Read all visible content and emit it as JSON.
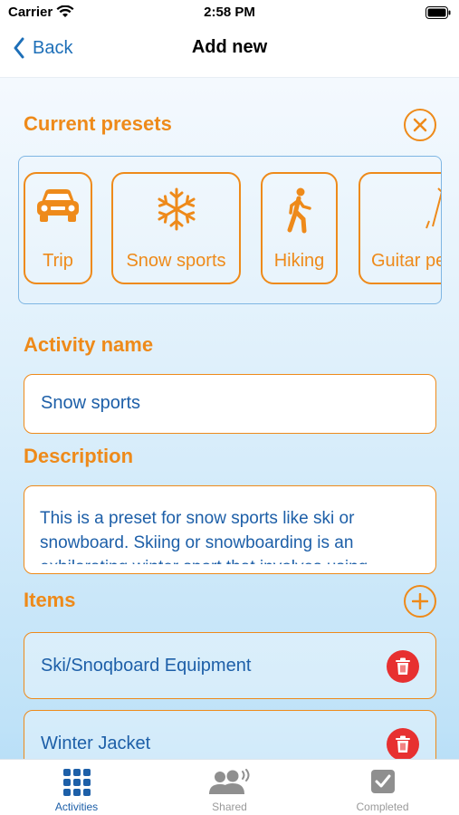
{
  "status_bar": {
    "carrier": "Carrier",
    "time": "2:58 PM"
  },
  "nav": {
    "back_label": "Back",
    "title": "Add new"
  },
  "presets": {
    "title": "Current presets",
    "items": [
      {
        "label": "Trip",
        "icon": "car-icon"
      },
      {
        "label": "Snow sports",
        "icon": "snowflake-icon"
      },
      {
        "label": "Hiking",
        "icon": "walking-person-icon"
      },
      {
        "label": "Guitar pe",
        "icon": "guitar-icon"
      }
    ]
  },
  "activity_name": {
    "label": "Activity name",
    "value": "Snow sports"
  },
  "description": {
    "label": "Description",
    "value": "This is a preset for snow sports like ski or snowboard. Skiing or snowboarding is an exhilarating winter sport that involves using"
  },
  "items_section": {
    "title": "Items",
    "items": [
      {
        "label": "Ski/Snoqboard Equipment"
      },
      {
        "label": "Winter Jacket"
      }
    ]
  },
  "tabs": [
    {
      "label": "Activities",
      "icon": "grid-icon",
      "active": true
    },
    {
      "label": "Shared",
      "icon": "people-icon",
      "active": false
    },
    {
      "label": "Completed",
      "icon": "checkbox-icon",
      "active": false
    }
  ],
  "colors": {
    "accent": "#ee8a1a",
    "text_blue": "#1d5fa8",
    "delete_red": "#e73030"
  }
}
